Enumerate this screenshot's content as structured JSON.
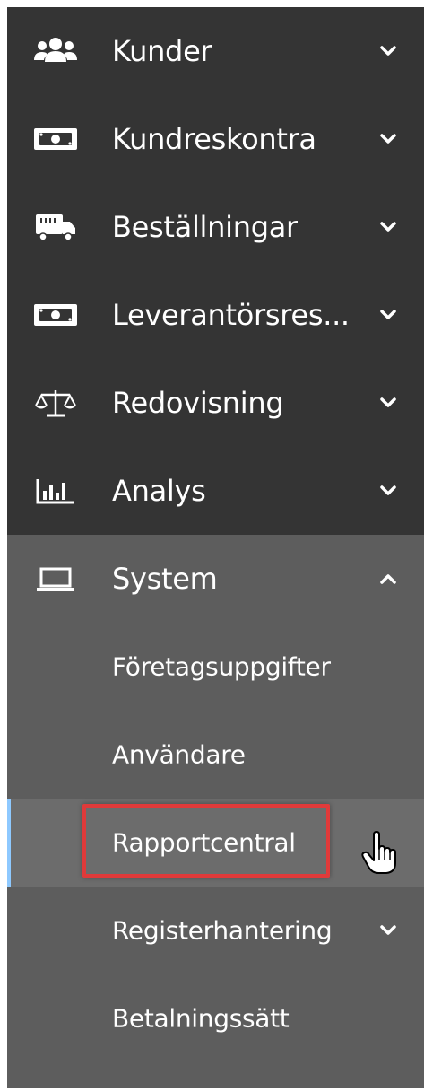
{
  "nav": {
    "items": [
      {
        "label": "Kunder",
        "icon": "users-icon"
      },
      {
        "label": "Kundreskontra",
        "icon": "money-bill-icon"
      },
      {
        "label": "Beställningar",
        "icon": "delivery-truck-icon"
      },
      {
        "label": "Leverantörsres...",
        "icon": "money-bill-icon"
      },
      {
        "label": "Redovisning",
        "icon": "balance-scale-icon"
      },
      {
        "label": "Analys",
        "icon": "bar-chart-icon"
      }
    ],
    "system": {
      "label": "System",
      "icon": "laptop-icon",
      "expanded": true,
      "sub_items": [
        {
          "label": "Företagsuppgifter"
        },
        {
          "label": "Användare"
        },
        {
          "label": "Rapportcentral",
          "active": true
        },
        {
          "label": "Registerhantering",
          "has_children": true
        },
        {
          "label": "Betalningssätt"
        }
      ]
    }
  },
  "colors": {
    "nav_bg": "#343434",
    "system_bg": "#5d5d5d",
    "active_bg": "#6c6c6c",
    "active_indicator": "#8ec9ff",
    "highlight_border": "#e03a3a",
    "text": "#ffffff"
  }
}
